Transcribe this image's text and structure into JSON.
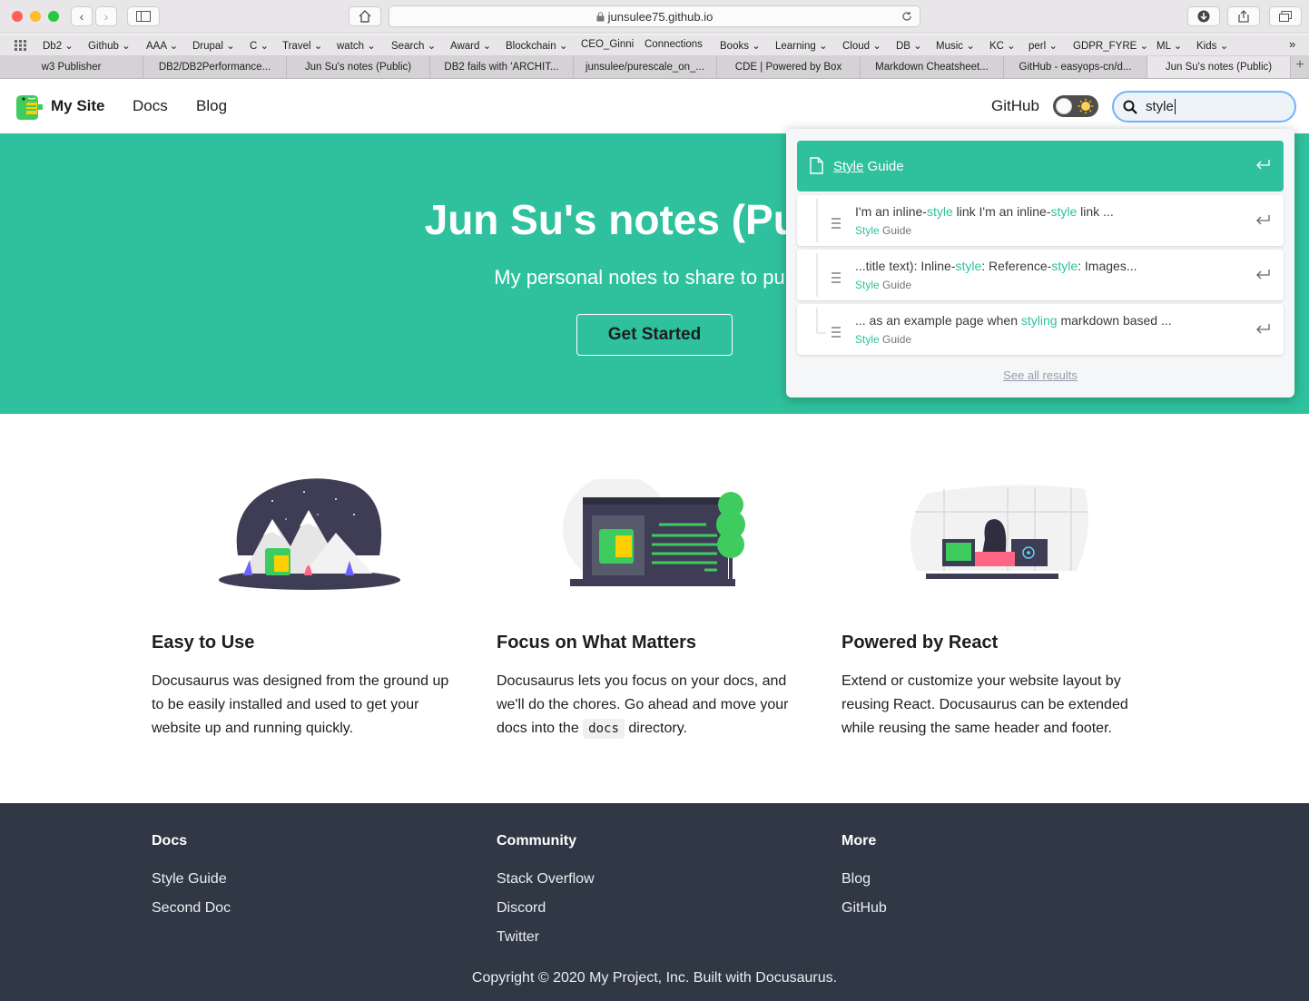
{
  "browser": {
    "url": "junsulee75.github.io",
    "bookmarks": [
      "Db2",
      "Github",
      "AAA",
      "Drupal",
      "C",
      "Travel",
      "watch",
      "Search",
      "Award",
      "Blockchain",
      "CEO_Ginni",
      "Connections",
      "Books",
      "Learning",
      "Cloud",
      "DB",
      "Music",
      "KC",
      "perl",
      "GDPR_FYRE",
      "ML",
      "Kids"
    ],
    "tabs": [
      "w3 Publisher",
      "DB2/DB2Performance...",
      "Jun Su's notes (Public)",
      "DB2 fails with 'ARCHIT...",
      "junsulee/purescale_on_...",
      "CDE | Powered by Box",
      "Markdown Cheatsheet...",
      "GitHub - easyops-cn/d...",
      "Jun Su's notes (Public)"
    ]
  },
  "navbar": {
    "brand": "My Site",
    "links": [
      "Docs",
      "Blog"
    ],
    "github": "GitHub",
    "search_value": "style"
  },
  "hero": {
    "title": "Jun Su's notes (Public)",
    "subtitle": "My personal notes to share to public",
    "cta": "Get Started"
  },
  "search": {
    "top_hit": {
      "match": "Style",
      "rest": " Guide"
    },
    "hits": [
      {
        "parts": [
          "I'm an inline-",
          "style",
          " link I'm an inline-",
          "style",
          " link ..."
        ],
        "crumb_match": "Style",
        "crumb_rest": " Guide"
      },
      {
        "parts": [
          "...title text): Inline-",
          "style",
          ": Reference-",
          "style",
          ": Images..."
        ],
        "crumb_match": "Style",
        "crumb_rest": " Guide"
      },
      {
        "parts": [
          "... as an example page when ",
          "styling",
          " markdown based ..."
        ],
        "crumb_match": "Style",
        "crumb_rest": " Guide"
      }
    ],
    "see_all": "See all results"
  },
  "features": [
    {
      "title": "Easy to Use",
      "text_a": "Docusaurus was designed from the ground up",
      "text_b": "to be easily installed and used to get your",
      "text_c": "website up and running quickly."
    },
    {
      "title": "Focus on What Matters",
      "text_a": "Docusaurus lets you focus on your docs, and",
      "text_b": "we'll do the chores. Go ahead and move your",
      "pre": "docs into the ",
      "code": "docs",
      "post": " directory."
    },
    {
      "title": "Powered by React",
      "text_a": "Extend or customize your website layout by",
      "text_b": "reusing React. Docusaurus can be extended",
      "text_c": "while reusing the same header and footer."
    }
  ],
  "footer": {
    "cols": [
      {
        "title": "Docs",
        "links": [
          "Style Guide",
          "Second Doc"
        ]
      },
      {
        "title": "Community",
        "links": [
          "Stack Overflow",
          "Discord",
          "Twitter"
        ]
      },
      {
        "title": "More",
        "links": [
          "Blog",
          "GitHub"
        ]
      }
    ],
    "copyright": "Copyright © 2020 My Project, Inc. Built with Docusaurus."
  },
  "colors": {
    "primary": "#2fc19d",
    "footer_bg": "#303846"
  }
}
